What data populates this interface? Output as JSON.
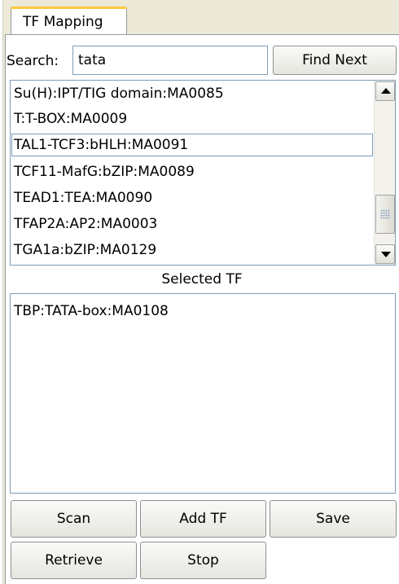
{
  "tabs": [
    {
      "label": "TF Mapping"
    }
  ],
  "search": {
    "label": "Search:",
    "value": "tata",
    "find_next_label": "Find Next"
  },
  "tf_list": {
    "items": [
      {
        "label": "Su(H):IPT/TIG domain:MA0085"
      },
      {
        "label": "T:T-BOX:MA0009"
      },
      {
        "label": "TAL1-TCF3:bHLH:MA0091",
        "focused": true
      },
      {
        "label": "TCF11-MafG:bZIP:MA0089"
      },
      {
        "label": "TEAD1:TEA:MA0090"
      },
      {
        "label": "TFAP2A:AP2:MA0003"
      },
      {
        "label": "TGA1a:bZIP:MA0129"
      }
    ]
  },
  "selected": {
    "header": "Selected TF",
    "items": [
      {
        "label": "TBP:TATA-box:MA0108"
      }
    ]
  },
  "buttons": {
    "scan": "Scan",
    "add_tf": "Add TF",
    "save": "Save",
    "retrieve": "Retrieve",
    "stop": "Stop"
  },
  "colors": {
    "background": "#ece9d8",
    "border": "#7f9db9",
    "tab_accent": "#ffc83c"
  }
}
